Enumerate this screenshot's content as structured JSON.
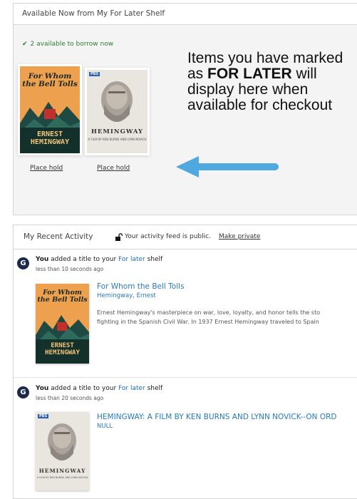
{
  "top_panel": {
    "header": "Available Now from My For Later Shelf",
    "status": "2 available to borrow now",
    "items": [
      {
        "title_line1": "For Whom",
        "title_line2": "the Bell Tolls",
        "author_line1": "ERNEST",
        "author_line2": "HEMINGWAY",
        "action": "Place hold"
      },
      {
        "badge": "PBS",
        "author": "HEMINGWAY",
        "byline": "A FILM BY KEN BURNS AND LYNN NOVICK",
        "action": "Place hold"
      }
    ]
  },
  "callout": {
    "part1": "Items you have marked as ",
    "bold1": "FOR LATER",
    "part2": " will display here when available for checkout"
  },
  "activity": {
    "title": "My Recent Activity",
    "feed_status": "Your activity feed is public.",
    "make_private": "Make private",
    "entries": [
      {
        "avatar": "G",
        "you": "You",
        "action": " added a title to your ",
        "shelf": "For later",
        "shelf_suffix": " shelf",
        "time": "less than 10 seconds ago",
        "item_title": "For Whom the Bell Tolls",
        "item_author": "Hemingway, Ernest",
        "desc_line1": "Ernest Hemingway's masterpiece on war, love, loyalty, and honor tells the sto",
        "desc_line2": "fighting in the Spanish Civil War. In 1937 Ernest Hemingway traveled to Spain"
      },
      {
        "avatar": "G",
        "you": "You",
        "action": " added a title to your ",
        "shelf": "For later",
        "shelf_suffix": " shelf",
        "time": "less than 20 seconds ago",
        "item_title": "HEMINGWAY: A FILM BY KEN BURNS AND LYNN NOVICK--ON ORD",
        "item_author": "NULL"
      }
    ]
  },
  "colors": {
    "link_blue": "#2a7ab0",
    "arrow_blue": "#4fa8de",
    "status_green": "#2e7d32",
    "avatar_navy": "#1c2a4a"
  },
  "icons": {
    "status": "check-icon",
    "feed": "unlock-icon",
    "arrow": "arrow-left-icon"
  }
}
